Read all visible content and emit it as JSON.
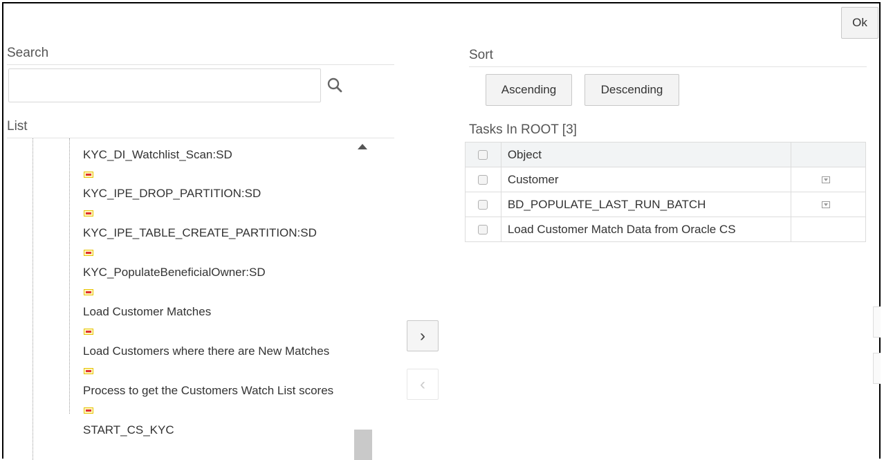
{
  "ok_label": "Ok",
  "search": {
    "title": "Search",
    "value": "",
    "placeholder": ""
  },
  "list": {
    "title": "List",
    "items": [
      "KYC_DI_Watchlist_Scan:SD",
      "KYC_IPE_DROP_PARTITION:SD",
      "KYC_IPE_TABLE_CREATE_PARTITION:SD",
      "KYC_PopulateBeneficialOwner:SD",
      "Load Customer Matches",
      "Load Customers where there are New Matches",
      "Process to get the Customers Watch List scores",
      "START_CS_KYC"
    ]
  },
  "move_right_label": "›",
  "move_left_label": "‹",
  "sort": {
    "title": "Sort",
    "ascending_label": "Ascending",
    "descending_label": "Descending"
  },
  "tasks": {
    "title": "Tasks In ROOT [3]",
    "header": "Object",
    "rows": [
      {
        "object": "Customer",
        "has_menu": true
      },
      {
        "object": "BD_POPULATE_LAST_RUN_BATCH",
        "has_menu": true
      },
      {
        "object": "Load Customer Match Data from Oracle CS",
        "has_menu": false
      }
    ]
  },
  "icons": {
    "search": "search-icon",
    "task": "task-icon",
    "dropdown": "dropdown-icon"
  }
}
